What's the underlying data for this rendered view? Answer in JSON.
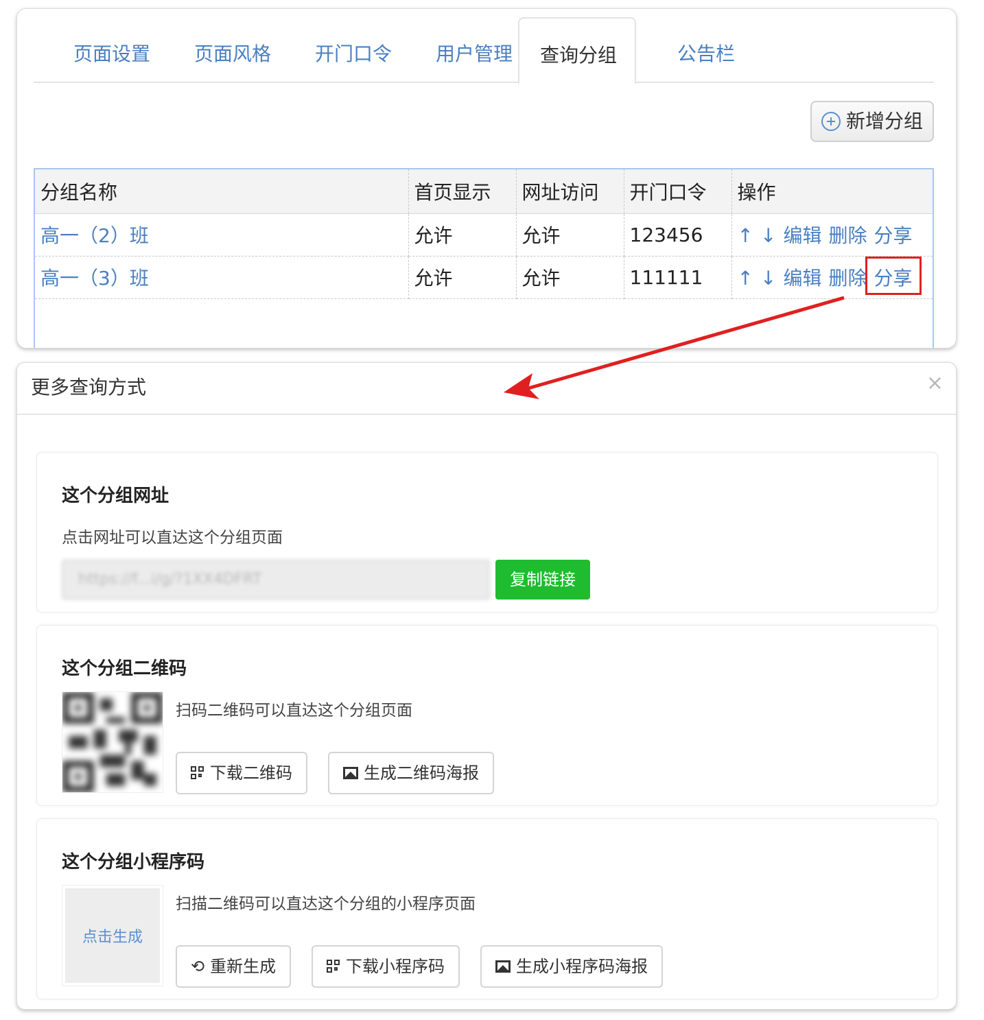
{
  "tabs": [
    "页面设置",
    "页面风格",
    "开门口令",
    "用户管理",
    "查询分组",
    "公告栏"
  ],
  "active_tab": "查询分组",
  "add_group_label": "新增分组",
  "table": {
    "headers": [
      "分组名称",
      "首页显示",
      "网址访问",
      "开门口令",
      "操作"
    ],
    "rows": [
      {
        "name": "高一（2）班",
        "home": "允许",
        "url": "允许",
        "password": "123456"
      },
      {
        "name": "高一（3）班",
        "home": "允许",
        "url": "允许",
        "password": "111111"
      }
    ],
    "ops": {
      "up": "↑",
      "down": "↓",
      "edit": "编辑",
      "delete": "删除",
      "share": "分享"
    }
  },
  "modal": {
    "title": "更多查询方式",
    "close": "×",
    "url_card": {
      "title": "这个分组网址",
      "desc": "点击网址可以直达这个分组页面",
      "url_value": "https://f...i/g/?1XX4DFRT",
      "copy_label": "复制链接"
    },
    "qr_card": {
      "title": "这个分组二维码",
      "desc": "扫码二维码可以直达这个分组页面",
      "download_label": "下载二维码",
      "poster_label": "生成二维码海报"
    },
    "mp_card": {
      "title": "这个分组小程序码",
      "desc": "扫描二维码可以直达这个分组的小程序页面",
      "generate_label": "点击生成",
      "regenerate_label": "重新生成",
      "download_label": "下载小程序码",
      "poster_label": "生成小程序码海报"
    }
  },
  "colors": {
    "link": "#4a7fc1",
    "copy_button": "#1ebc2e",
    "highlight": "#e02020"
  }
}
